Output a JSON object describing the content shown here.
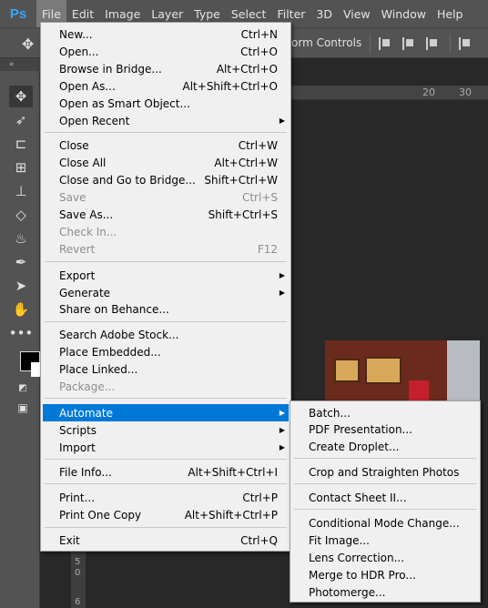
{
  "app": {
    "logo": "Ps"
  },
  "menubar": {
    "items": [
      "File",
      "Edit",
      "Image",
      "Layer",
      "Type",
      "Select",
      "Filter",
      "3D",
      "View",
      "Window",
      "Help"
    ]
  },
  "optionsbar": {
    "form_controls_label": "orm Controls"
  },
  "panel": {
    "collapse": "«"
  },
  "ruler_top": [
    "20",
    "30"
  ],
  "ruler_left": [
    "5",
    "0",
    "6"
  ],
  "file_menu": {
    "items": [
      {
        "label": "New...",
        "shortcut": "Ctrl+N"
      },
      {
        "label": "Open...",
        "shortcut": "Ctrl+O"
      },
      {
        "label": "Browse in Bridge...",
        "shortcut": "Alt+Ctrl+O"
      },
      {
        "label": "Open As...",
        "shortcut": "Alt+Shift+Ctrl+O"
      },
      {
        "label": "Open as Smart Object...",
        "shortcut": ""
      },
      {
        "label": "Open Recent",
        "shortcut": "",
        "submenu": true
      },
      {
        "label": "Close",
        "shortcut": "Ctrl+W"
      },
      {
        "label": "Close All",
        "shortcut": "Alt+Ctrl+W"
      },
      {
        "label": "Close and Go to Bridge...",
        "shortcut": "Shift+Ctrl+W"
      },
      {
        "label": "Save",
        "shortcut": "Ctrl+S",
        "disabled": true
      },
      {
        "label": "Save As...",
        "shortcut": "Shift+Ctrl+S"
      },
      {
        "label": "Check In...",
        "shortcut": "",
        "disabled": true
      },
      {
        "label": "Revert",
        "shortcut": "F12",
        "disabled": true
      },
      {
        "label": "Export",
        "shortcut": "",
        "submenu": true
      },
      {
        "label": "Generate",
        "shortcut": "",
        "submenu": true
      },
      {
        "label": "Share on Behance...",
        "shortcut": ""
      },
      {
        "label": "Search Adobe Stock...",
        "shortcut": ""
      },
      {
        "label": "Place Embedded...",
        "shortcut": ""
      },
      {
        "label": "Place Linked...",
        "shortcut": ""
      },
      {
        "label": "Package...",
        "shortcut": "",
        "disabled": true
      },
      {
        "label": "Automate",
        "shortcut": "",
        "submenu": true,
        "highlight": true
      },
      {
        "label": "Scripts",
        "shortcut": "",
        "submenu": true
      },
      {
        "label": "Import",
        "shortcut": "",
        "submenu": true
      },
      {
        "label": "File Info...",
        "shortcut": "Alt+Shift+Ctrl+I"
      },
      {
        "label": "Print...",
        "shortcut": "Ctrl+P"
      },
      {
        "label": "Print One Copy",
        "shortcut": "Alt+Shift+Ctrl+P"
      },
      {
        "label": "Exit",
        "shortcut": "Ctrl+Q"
      }
    ]
  },
  "automate_menu": {
    "items": [
      {
        "label": "Batch..."
      },
      {
        "label": "PDF Presentation..."
      },
      {
        "label": "Create Droplet..."
      },
      {
        "label": "Crop and Straighten Photos"
      },
      {
        "label": "Contact Sheet II..."
      },
      {
        "label": "Conditional Mode Change..."
      },
      {
        "label": "Fit Image..."
      },
      {
        "label": "Lens Correction..."
      },
      {
        "label": "Merge to HDR Pro..."
      },
      {
        "label": "Photomerge..."
      }
    ]
  },
  "colors": {
    "highlight": "#0078d7",
    "ps_blue": "#31a8ff",
    "menu_bg": "#f0f0f0",
    "chrome": "#535353"
  }
}
